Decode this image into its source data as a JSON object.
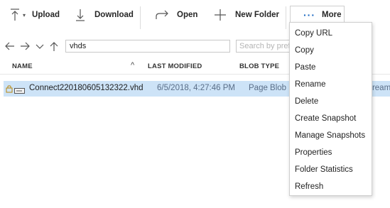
{
  "toolbar": {
    "upload_label": "Upload",
    "download_label": "Download",
    "open_label": "Open",
    "new_folder_label": "New Folder",
    "more_label": "More",
    "more_dots": "···"
  },
  "nav": {
    "path_value": "vhds",
    "search_placeholder": "Search by prefix"
  },
  "table": {
    "columns": [
      "NAME",
      "LAST MODIFIED",
      "BLOB TYPE"
    ],
    "sort_indicator": "^",
    "rows": [
      {
        "name": "Connect220180605132322.vhd",
        "last_modified": "6/5/2018, 4:27:46 PM",
        "blob_type": "Page Blob",
        "extra": "stream"
      }
    ]
  },
  "menu": {
    "items": [
      "Copy URL",
      "Copy",
      "Paste",
      "Rename",
      "Delete",
      "Create Snapshot",
      "Manage Snapshots",
      "Properties",
      "Folder Statistics",
      "Refresh"
    ]
  },
  "colors": {
    "accent": "#1565c0",
    "selection": "#cde3f7",
    "row_text": "#1e1e1e",
    "muted_text": "#5a6e88"
  }
}
